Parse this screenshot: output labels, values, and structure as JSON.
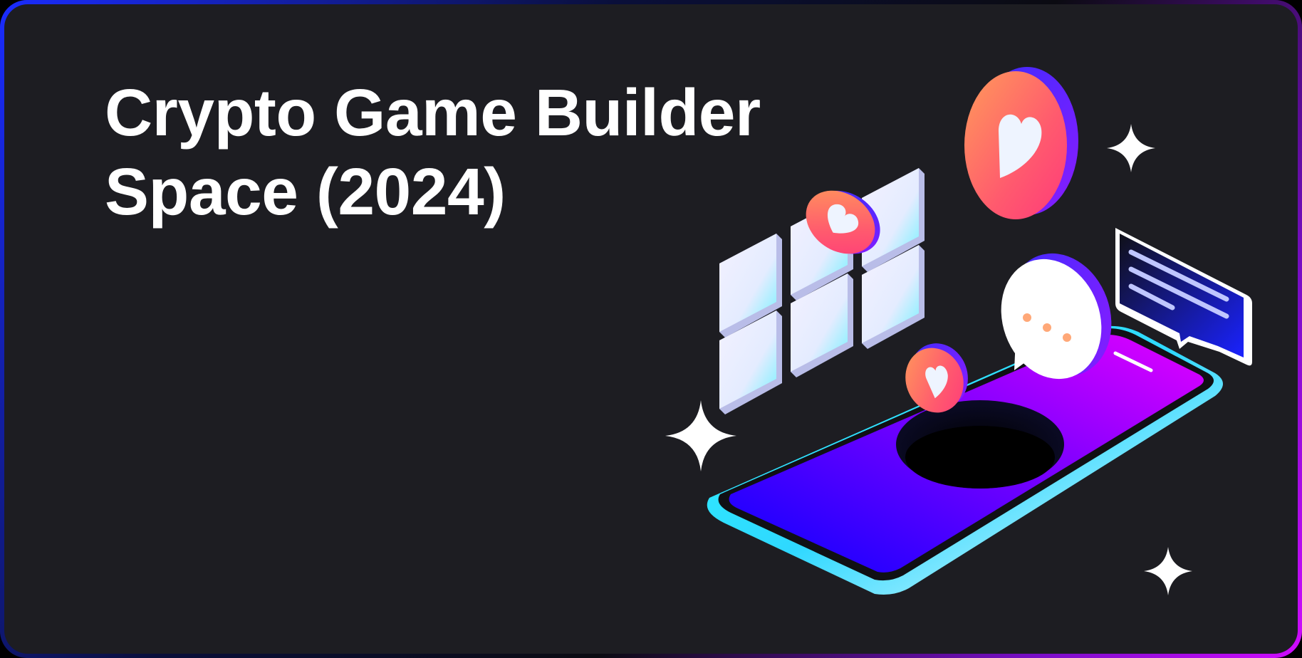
{
  "hero": {
    "title_line_1": "Crypto Game Builder",
    "title_line_2": "Space (2024)"
  },
  "illustration": {
    "icons": [
      "phone-icon",
      "heart-icon",
      "speech-bubble-icon",
      "chat-message-icon",
      "sparkle-icon",
      "tile-grid-icon"
    ]
  },
  "colors": {
    "background": "#1d1d22",
    "text": "#ffffff",
    "border_start": "#1a2cff",
    "border_end": "#d00bff",
    "phone_screen_start": "#0a00ff",
    "phone_screen_end": "#e300ff",
    "phone_edge": "#2ff7ff",
    "heart_coin": "#ff5a6e"
  }
}
